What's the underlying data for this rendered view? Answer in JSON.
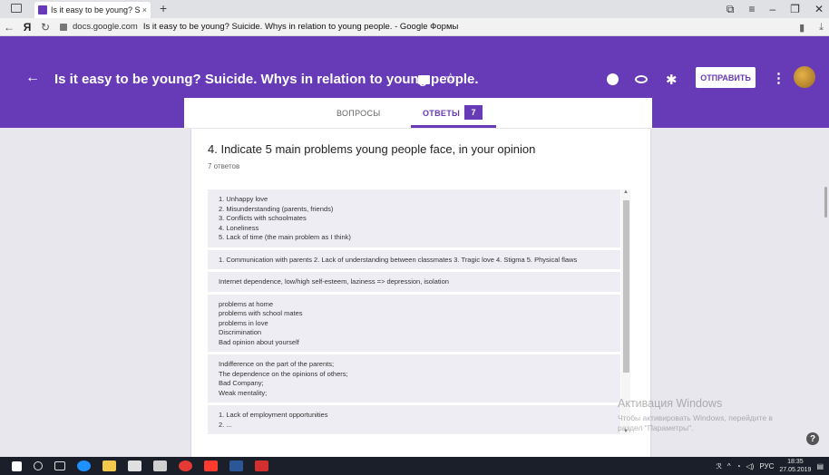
{
  "browser": {
    "tab_title": "Is it easy to be young? S",
    "tab_close": "×",
    "new_tab": "+",
    "url_domain": "docs.google.com",
    "page_title": "Is it easy to be young? Suicide. Whys in relation to young people. - Google Формы",
    "yandex_logo": "Я"
  },
  "header": {
    "title": "Is it easy to be young? Suicide. Whys in relation to young people.",
    "send_label": "ОТПРАВИТЬ",
    "accent_color": "#673ab7"
  },
  "tabs": {
    "questions": "ВОПРОСЫ",
    "answers": "ОТВЕТЫ",
    "answers_count": "7"
  },
  "question": {
    "title": "4. Indicate 5 main problems young people face, in your opinion",
    "count": "7 ответов"
  },
  "responses": [
    "1. Unhappy love\n2. Misunderstanding (parents, friends)\n3. Conflicts with schoolmates\n4. Loneliness\n5. Lack of time (the main problem as I think)",
    "1. Communication with parents 2. Lack of understanding between classmates 3. Tragic love 4. Stigma 5. Physical flaws",
    "Internet dependence, low/high self-esteem, laziness => depression, isolation",
    "problems at home\nproblems with school mates\nproblems in love\nDiscrimination\nBad opinion about yourself",
    "Indifference on the part of the parents;\nThe dependence on the opinions of others;\nBad Company;\nWeak mentality;",
    "1. Lack of employment opportunities\n2. ..."
  ],
  "watermark": {
    "line1": "Активация Windows",
    "line2": "Чтобы активировать Windows, перейдите в",
    "line3": "раздел \"Параметры\"."
  },
  "taskbar": {
    "lang": "РУС",
    "time": "18:35",
    "date": "27.05.2019"
  }
}
